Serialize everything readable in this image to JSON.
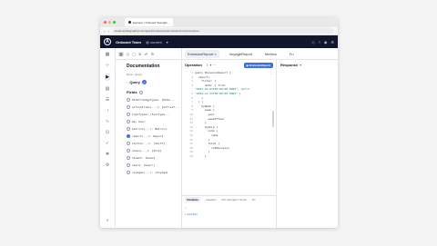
{
  "browser": {
    "tab_title": "Explorer | Onboard Team@c...",
    "url": "studio.apollographql.com/graph/onboard-team/variant/current/explorer"
  },
  "header": {
    "logo_letter": "A",
    "graph_name": "Onboard Team",
    "variant": "@ current",
    "caret": "▾"
  },
  "docs": {
    "title": "Documentation",
    "breadcrumb": "Root  ›  Query",
    "query_label": "Query",
    "fields_label": "Fields",
    "fields": [
      {
        "name": "DCSStrategyTypes: [DCSS...",
        "checked": false
      },
      {
        "name": "activeTiles(...): [ActiveT...",
        "checked": false
      },
      {
        "name": "fuelTypes: [FuelType...",
        "checked": false
      },
      {
        "name": "me: User",
        "checked": false
      },
      {
        "name": "metrics(...): Metrics",
        "checked": false
      },
      {
        "name": "report(...): Report",
        "checked": true
      },
      {
        "name": "shifts(...): [Shift]",
        "checked": false
      },
      {
        "name": "ships(...): [Ship]",
        "checked": false
      },
      {
        "name": "tenant: Tenant",
        "checked": false
      },
      {
        "name": "users: [User!]",
        "checked": false
      },
      {
        "name": "voyages(...): [Voyage]",
        "checked": false
      }
    ]
  },
  "tabs": [
    {
      "label": "EmissionReport",
      "active": true
    },
    {
      "label": "VoyageReport",
      "active": false
    },
    {
      "label": "Metrics",
      "active": false
    },
    {
      "label": "Fu",
      "active": false
    }
  ],
  "operation": {
    "title": "Operation",
    "run_label": "EmissionReport",
    "code_lines": [
      "query EmissionReport {",
      "  report(",
      "    filter: {",
      "      date: { from:",
      "\"2023-01-01T00:00:00.000Z\", until:",
      "\"2024-12-31T00:00:00.000Z\" }",
      "    }",
      "  ) {",
      "    byWeek {",
      "      week {",
      "        year",
      "        weekOfYear",
      "      }",
      "      byShip {",
      "        node {",
      "          name",
      "        }",
      "        total {",
      "          co2Emission",
      "        }",
      "      }"
    ],
    "line_numbers": [
      "1",
      "2",
      "3",
      "4",
      "",
      "5",
      "6",
      "7",
      "8",
      "9",
      "10",
      "11",
      "12",
      "13",
      "14",
      "15",
      "16",
      "17",
      "18",
      "19",
      "20"
    ]
  },
  "variables": {
    "tabs": [
      "Variables",
      "Headers",
      "Pre-Operation Script",
      "Po"
    ],
    "line_number": "1",
    "add_files": "+ Add files"
  },
  "response": {
    "title": "Response",
    "caret": "▾"
  }
}
